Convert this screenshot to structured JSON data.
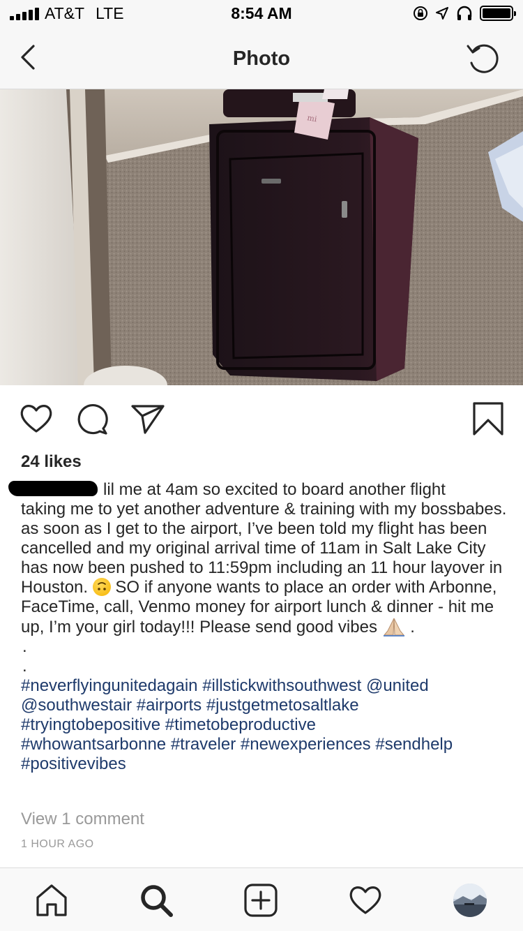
{
  "status_bar": {
    "carrier": "AT&T",
    "network": "LTE",
    "time": "8:54 AM"
  },
  "header": {
    "title": "Photo"
  },
  "post": {
    "likes": "24 likes",
    "caption": {
      "line_1": "lil me at 4am so excited to board another flight",
      "body": "taking me to yet another adventure & training with my bossbabes. as soon as I get to the airport, I’ve been told my flight has been cancelled and my original arrival time of 11am in Salt Lake City has now been pushed to 11:59pm including an 11 hour layover in Houston.",
      "body_2": "SO if anyone wants to place an order with Arbonne, FaceTime, call, Venmo money for airport lunch & dinner - hit me up, I’m your girl today!!! Please send good vibes",
      "trail": ".",
      "dot_1": ".",
      "dot_2": "."
    },
    "tags": [
      "#neverflyingunitedagain",
      "#illstickwithsouthwest",
      "@united",
      "@southwestair",
      "#airports",
      "#justgetmetosaltlake",
      "#tryingtobepositive",
      "#timetobeproductive",
      "#whowantsarbonne",
      "#traveler",
      "#newexperiences",
      "#sendhelp",
      "#positivevibes"
    ],
    "view_comments": "View 1 comment",
    "time_ago": "1 HOUR AGO"
  },
  "icons": {
    "back": "chevron-left-icon",
    "refresh": "refresh-icon",
    "like": "heart-icon",
    "comment": "comment-icon",
    "share": "send-icon",
    "save": "bookmark-icon",
    "home": "home-icon",
    "search": "search-icon",
    "add": "add-post-icon",
    "activity": "heart-icon",
    "profile": "profile-avatar"
  },
  "colors": {
    "hashtag": "#1e3a6b",
    "secondary_text": "#999999",
    "bar_background": "#f7f7f7"
  }
}
